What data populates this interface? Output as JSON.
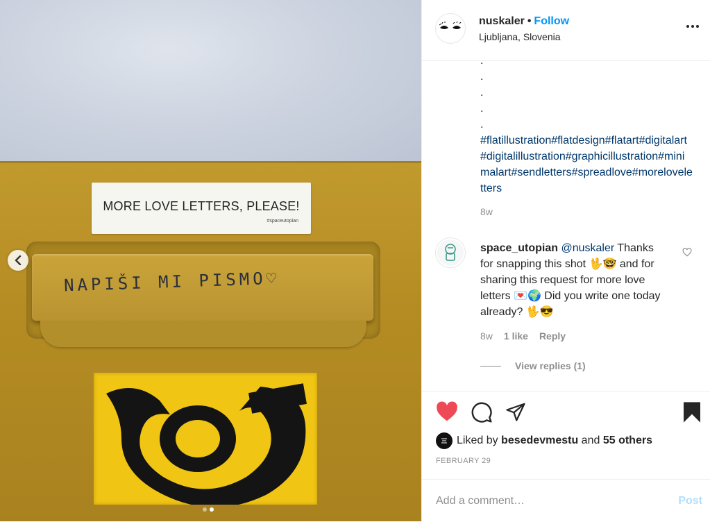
{
  "photo": {
    "sticker_text": "MORE LOVE LETTERS, PLEASE!",
    "sticker_tag": "#spaceutopian",
    "handwriting": "NAPIŠI MI PISMO♡",
    "carousel_dots": 2,
    "active_dot": 2
  },
  "header": {
    "username": "nuskaler",
    "separator": "•",
    "follow_label": "Follow",
    "location": "Ljubljana, Slovenia"
  },
  "caption": {
    "dot_lines": [
      ".",
      ".",
      ".",
      ".",
      "."
    ],
    "hashtags": "#flatillustration#flatdesign#flatart#digitalart#digitalillustration#graphicillustration#minimalart#sendletters#spreadlove#moreloveletters",
    "time": "8w"
  },
  "comment": {
    "username": "space_utopian",
    "mention": "@nuskaler",
    "text_part1": " Thanks for snapping this shot ",
    "emoji1": "🖖🤓",
    "text_part2": " and for sharing this request for more love letters ",
    "emoji2": "💌🌍",
    "text_part3": " Did you write one today already? ",
    "emoji3": "🖖😎",
    "time": "8w",
    "likes": "1 like",
    "reply_label": "Reply",
    "view_replies": "View replies (1)"
  },
  "likes": {
    "prefix": "Liked by ",
    "user": "besedevmestu",
    "and": " and ",
    "others": "55 others"
  },
  "date": "FEBRUARY 29",
  "add_comment": {
    "placeholder": "Add a comment…",
    "post_label": "Post"
  },
  "colors": {
    "accent": "#0095f6",
    "like_red": "#ed4956",
    "hashtag": "#00376b",
    "muted": "#8e8e8e"
  }
}
